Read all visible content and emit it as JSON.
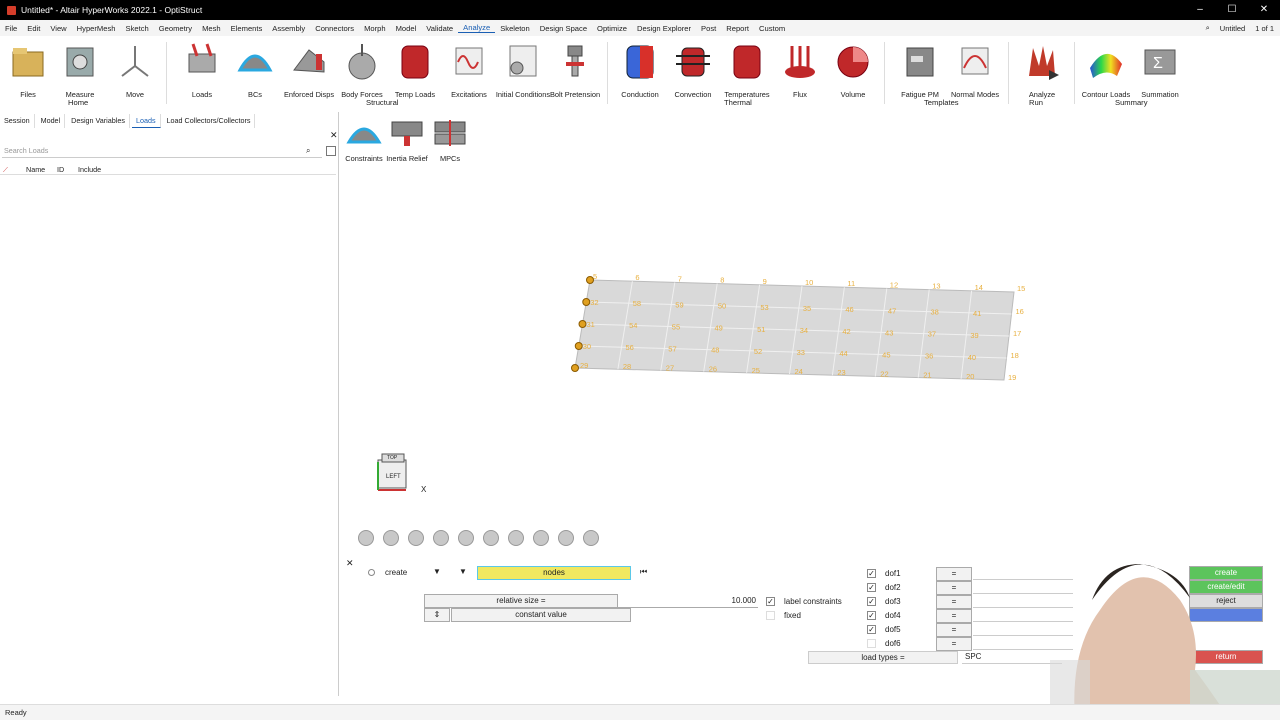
{
  "titlebar": {
    "title": "Untitled* - Altair HyperWorks 2022.1 - OptiStruct"
  },
  "menubar": {
    "items": [
      "File",
      "Edit",
      "View",
      "HyperMesh",
      "Sketch",
      "Geometry",
      "Mesh",
      "Elements",
      "Assembly",
      "Connectors",
      "Morph",
      "Model",
      "Validate",
      "Analyze",
      "Skeleton",
      "Design Space",
      "Optimize",
      "Design Explorer",
      "Post",
      "Report",
      "Custom"
    ],
    "active": "Analyze",
    "session": "Untitled",
    "page": "1 of 1"
  },
  "ribbon": {
    "home": {
      "files": "Files",
      "measure": "Measure",
      "move": "Move",
      "group": "Home"
    },
    "structural": {
      "loads": "Loads",
      "bcs": "BCs",
      "enforced": "Enforced Disps",
      "body": "Body Forces",
      "temp": "Temp Loads",
      "excitations": "Excitations",
      "initial": "Initial Conditions",
      "bolt": "Bolt Pretension",
      "group": "Structural"
    },
    "thermal": {
      "conduction": "Conduction",
      "convection": "Convection",
      "temperatures": "Temperatures",
      "flux": "Flux",
      "volume": "Volume",
      "group": "Thermal"
    },
    "templates": {
      "fatigue": "Fatigue PM",
      "normal": "Normal Modes",
      "group": "Templates"
    },
    "run": {
      "analyze": "Analyze",
      "group": "Run"
    },
    "summary": {
      "contour": "Contour Loads",
      "summation": "Summation",
      "group": "Summary"
    }
  },
  "subribbon": {
    "constraints": "Constraints",
    "inertia": "Inertia Relief",
    "mpcs": "MPCs"
  },
  "leftpanel": {
    "tabs": [
      "Session",
      "Model",
      "Design Variables",
      "Loads",
      "Load Collectors/Collectors"
    ],
    "active_tab": "Loads",
    "search_placeholder": "Search Loads",
    "columns": [
      "Name",
      "ID",
      "Include"
    ]
  },
  "mesh": {
    "top_ids": [
      "5",
      "6",
      "7",
      "8",
      "9",
      "10",
      "11",
      "12",
      "13",
      "14",
      "15"
    ],
    "right_ids": [
      "16",
      "17",
      "18",
      "19"
    ],
    "bottom_ids": [
      "29",
      "28",
      "27",
      "26",
      "25",
      "24",
      "23",
      "22",
      "21",
      "20"
    ],
    "row1": [
      "32",
      "58",
      "59",
      "50",
      "53",
      "35",
      "46",
      "47",
      "38",
      "41"
    ],
    "row2": [
      "31",
      "54",
      "55",
      "49",
      "51",
      "34",
      "42",
      "43",
      "37",
      "39"
    ],
    "row3": [
      "30",
      "56",
      "57",
      "48",
      "52",
      "33",
      "44",
      "45",
      "36",
      "40"
    ]
  },
  "triad": {
    "x_label": "X",
    "cube_top": "TOP",
    "cube_front": "LEFT"
  },
  "panel": {
    "mode": "create",
    "entity": "nodes",
    "relative_size_label": "relative size =",
    "relative_size_value": "10.000",
    "value_mode": "constant value",
    "label_constraints": "label constraints",
    "fixed": "fixed",
    "dofs": [
      {
        "label": "dof1",
        "checked": true,
        "eq": "="
      },
      {
        "label": "dof2",
        "checked": true,
        "eq": "="
      },
      {
        "label": "dof3",
        "checked": true,
        "eq": "="
      },
      {
        "label": "dof4",
        "checked": true,
        "eq": "="
      },
      {
        "label": "dof5",
        "checked": true,
        "eq": "="
      },
      {
        "label": "dof6",
        "checked": false,
        "eq": "="
      }
    ],
    "load_types_label": "load types =",
    "load_types_value": "SPC",
    "buttons": {
      "create": "create",
      "create_edit": "create/edit",
      "reject": "reject",
      "return": "return"
    }
  },
  "status": {
    "text": "Ready"
  }
}
